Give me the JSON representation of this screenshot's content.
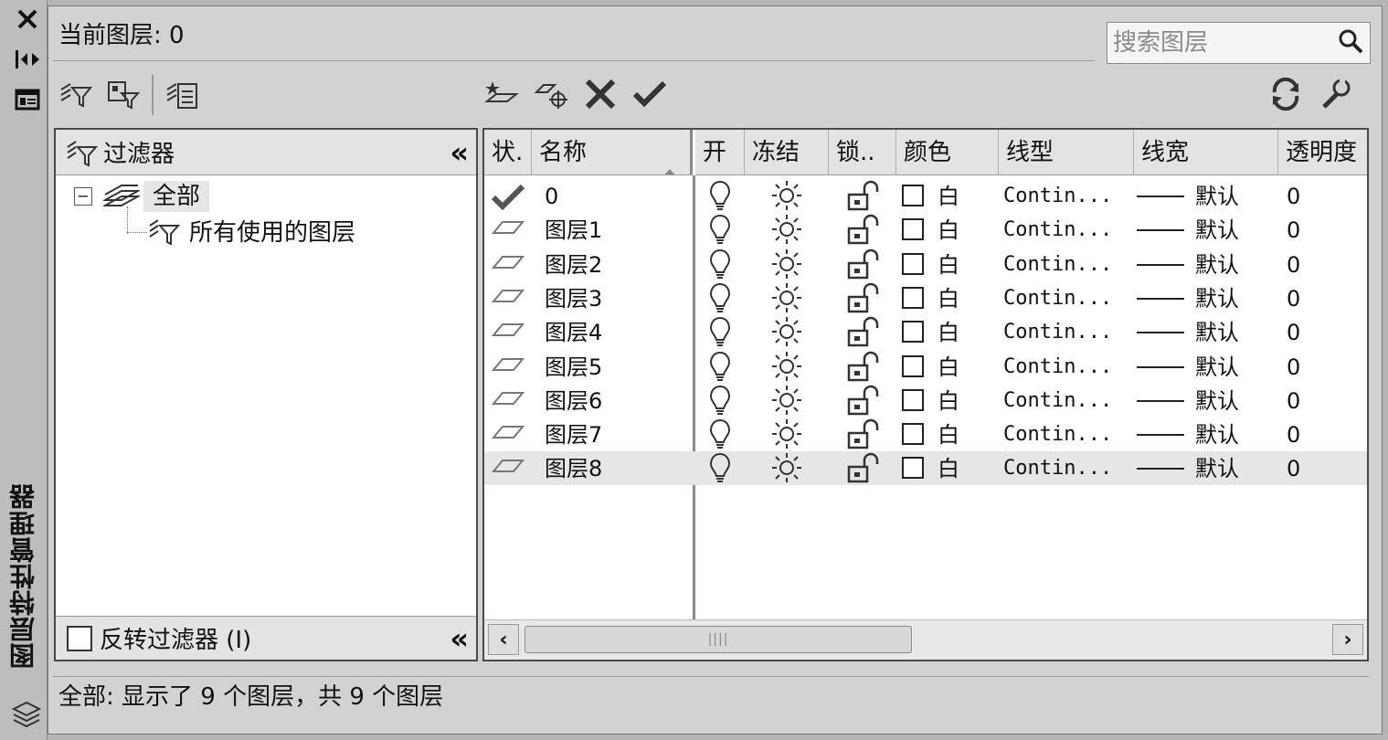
{
  "panel": {
    "vertical_title": "图层特性管理器"
  },
  "header": {
    "current_layer_label": "当前图层: 0",
    "search_placeholder": "搜索图层"
  },
  "filter_panel": {
    "title": "过滤器",
    "tree": [
      {
        "label": "全部",
        "selected": true,
        "expanded": true
      },
      {
        "label": "所有使用的图层"
      }
    ],
    "invert_label": "反转过滤器 (I)"
  },
  "columns": {
    "status": "状.",
    "name": "名称",
    "on": "开",
    "freeze": "冻结",
    "lock": "锁..",
    "color": "颜色",
    "linetype": "线型",
    "lineweight": "线宽",
    "transparency": "透明度"
  },
  "layers": [
    {
      "status": "current",
      "name": "0",
      "color": "白",
      "linetype": "Contin...",
      "lineweight": "默认",
      "transparency": "0"
    },
    {
      "status": "normal",
      "name": "图层1",
      "color": "白",
      "linetype": "Contin...",
      "lineweight": "默认",
      "transparency": "0"
    },
    {
      "status": "normal",
      "name": "图层2",
      "color": "白",
      "linetype": "Contin...",
      "lineweight": "默认",
      "transparency": "0"
    },
    {
      "status": "normal",
      "name": "图层3",
      "color": "白",
      "linetype": "Contin...",
      "lineweight": "默认",
      "transparency": "0"
    },
    {
      "status": "normal",
      "name": "图层4",
      "color": "白",
      "linetype": "Contin...",
      "lineweight": "默认",
      "transparency": "0"
    },
    {
      "status": "normal",
      "name": "图层5",
      "color": "白",
      "linetype": "Contin...",
      "lineweight": "默认",
      "transparency": "0"
    },
    {
      "status": "normal",
      "name": "图层6",
      "color": "白",
      "linetype": "Contin...",
      "lineweight": "默认",
      "transparency": "0"
    },
    {
      "status": "normal",
      "name": "图层7",
      "color": "白",
      "linetype": "Contin...",
      "lineweight": "默认",
      "transparency": "0"
    },
    {
      "status": "normal",
      "name": "图层8",
      "color": "白",
      "linetype": "Contin...",
      "lineweight": "默认",
      "transparency": "0",
      "selected": true
    }
  ],
  "status_bar": {
    "text": "全部: 显示了 9 个图层，共 9 个图层"
  },
  "icons": {
    "close": "close-icon",
    "autohide": "autohide-icon",
    "properties": "properties-icon",
    "search": "search-icon",
    "refresh": "refresh-icon",
    "settings": "settings-icon"
  }
}
